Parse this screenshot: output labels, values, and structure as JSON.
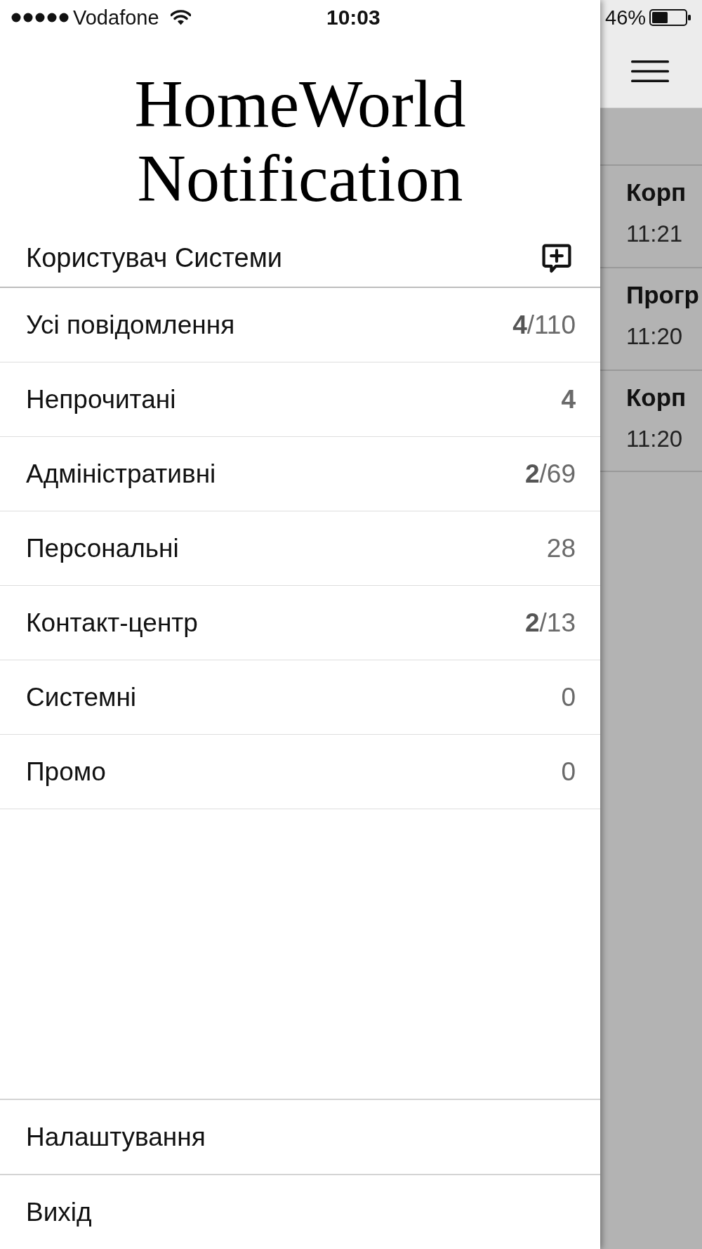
{
  "status_bar": {
    "carrier": "Vodafone",
    "time": "10:03",
    "battery": "46%"
  },
  "drawer": {
    "title": "HomeWorld Notification",
    "user": "Користувач Системи",
    "categories": [
      {
        "label": "Усі повідомлення",
        "count": "**4**/110",
        "count_bold": false
      },
      {
        "label": "Непрочитані",
        "count": "4",
        "count_bold": true
      },
      {
        "label": "Адміністративні",
        "count": "**2**/69",
        "count_bold": false
      },
      {
        "label": "Персональні",
        "count": "28",
        "count_bold": false
      },
      {
        "label": "Контакт-центр",
        "count": "**2**/13",
        "count_bold": false
      },
      {
        "label": "Системні",
        "count": "0",
        "count_bold": false
      },
      {
        "label": "Промо",
        "count": "0",
        "count_bold": false
      }
    ],
    "footer_items": [
      {
        "label": "Налаштування"
      },
      {
        "label": "Вихід"
      }
    ]
  },
  "messages": [
    {
      "title": "Корп",
      "time": "11:21"
    },
    {
      "title": "Прогр",
      "time": "11:20"
    },
    {
      "title": "Корп",
      "time": "11:20"
    }
  ]
}
